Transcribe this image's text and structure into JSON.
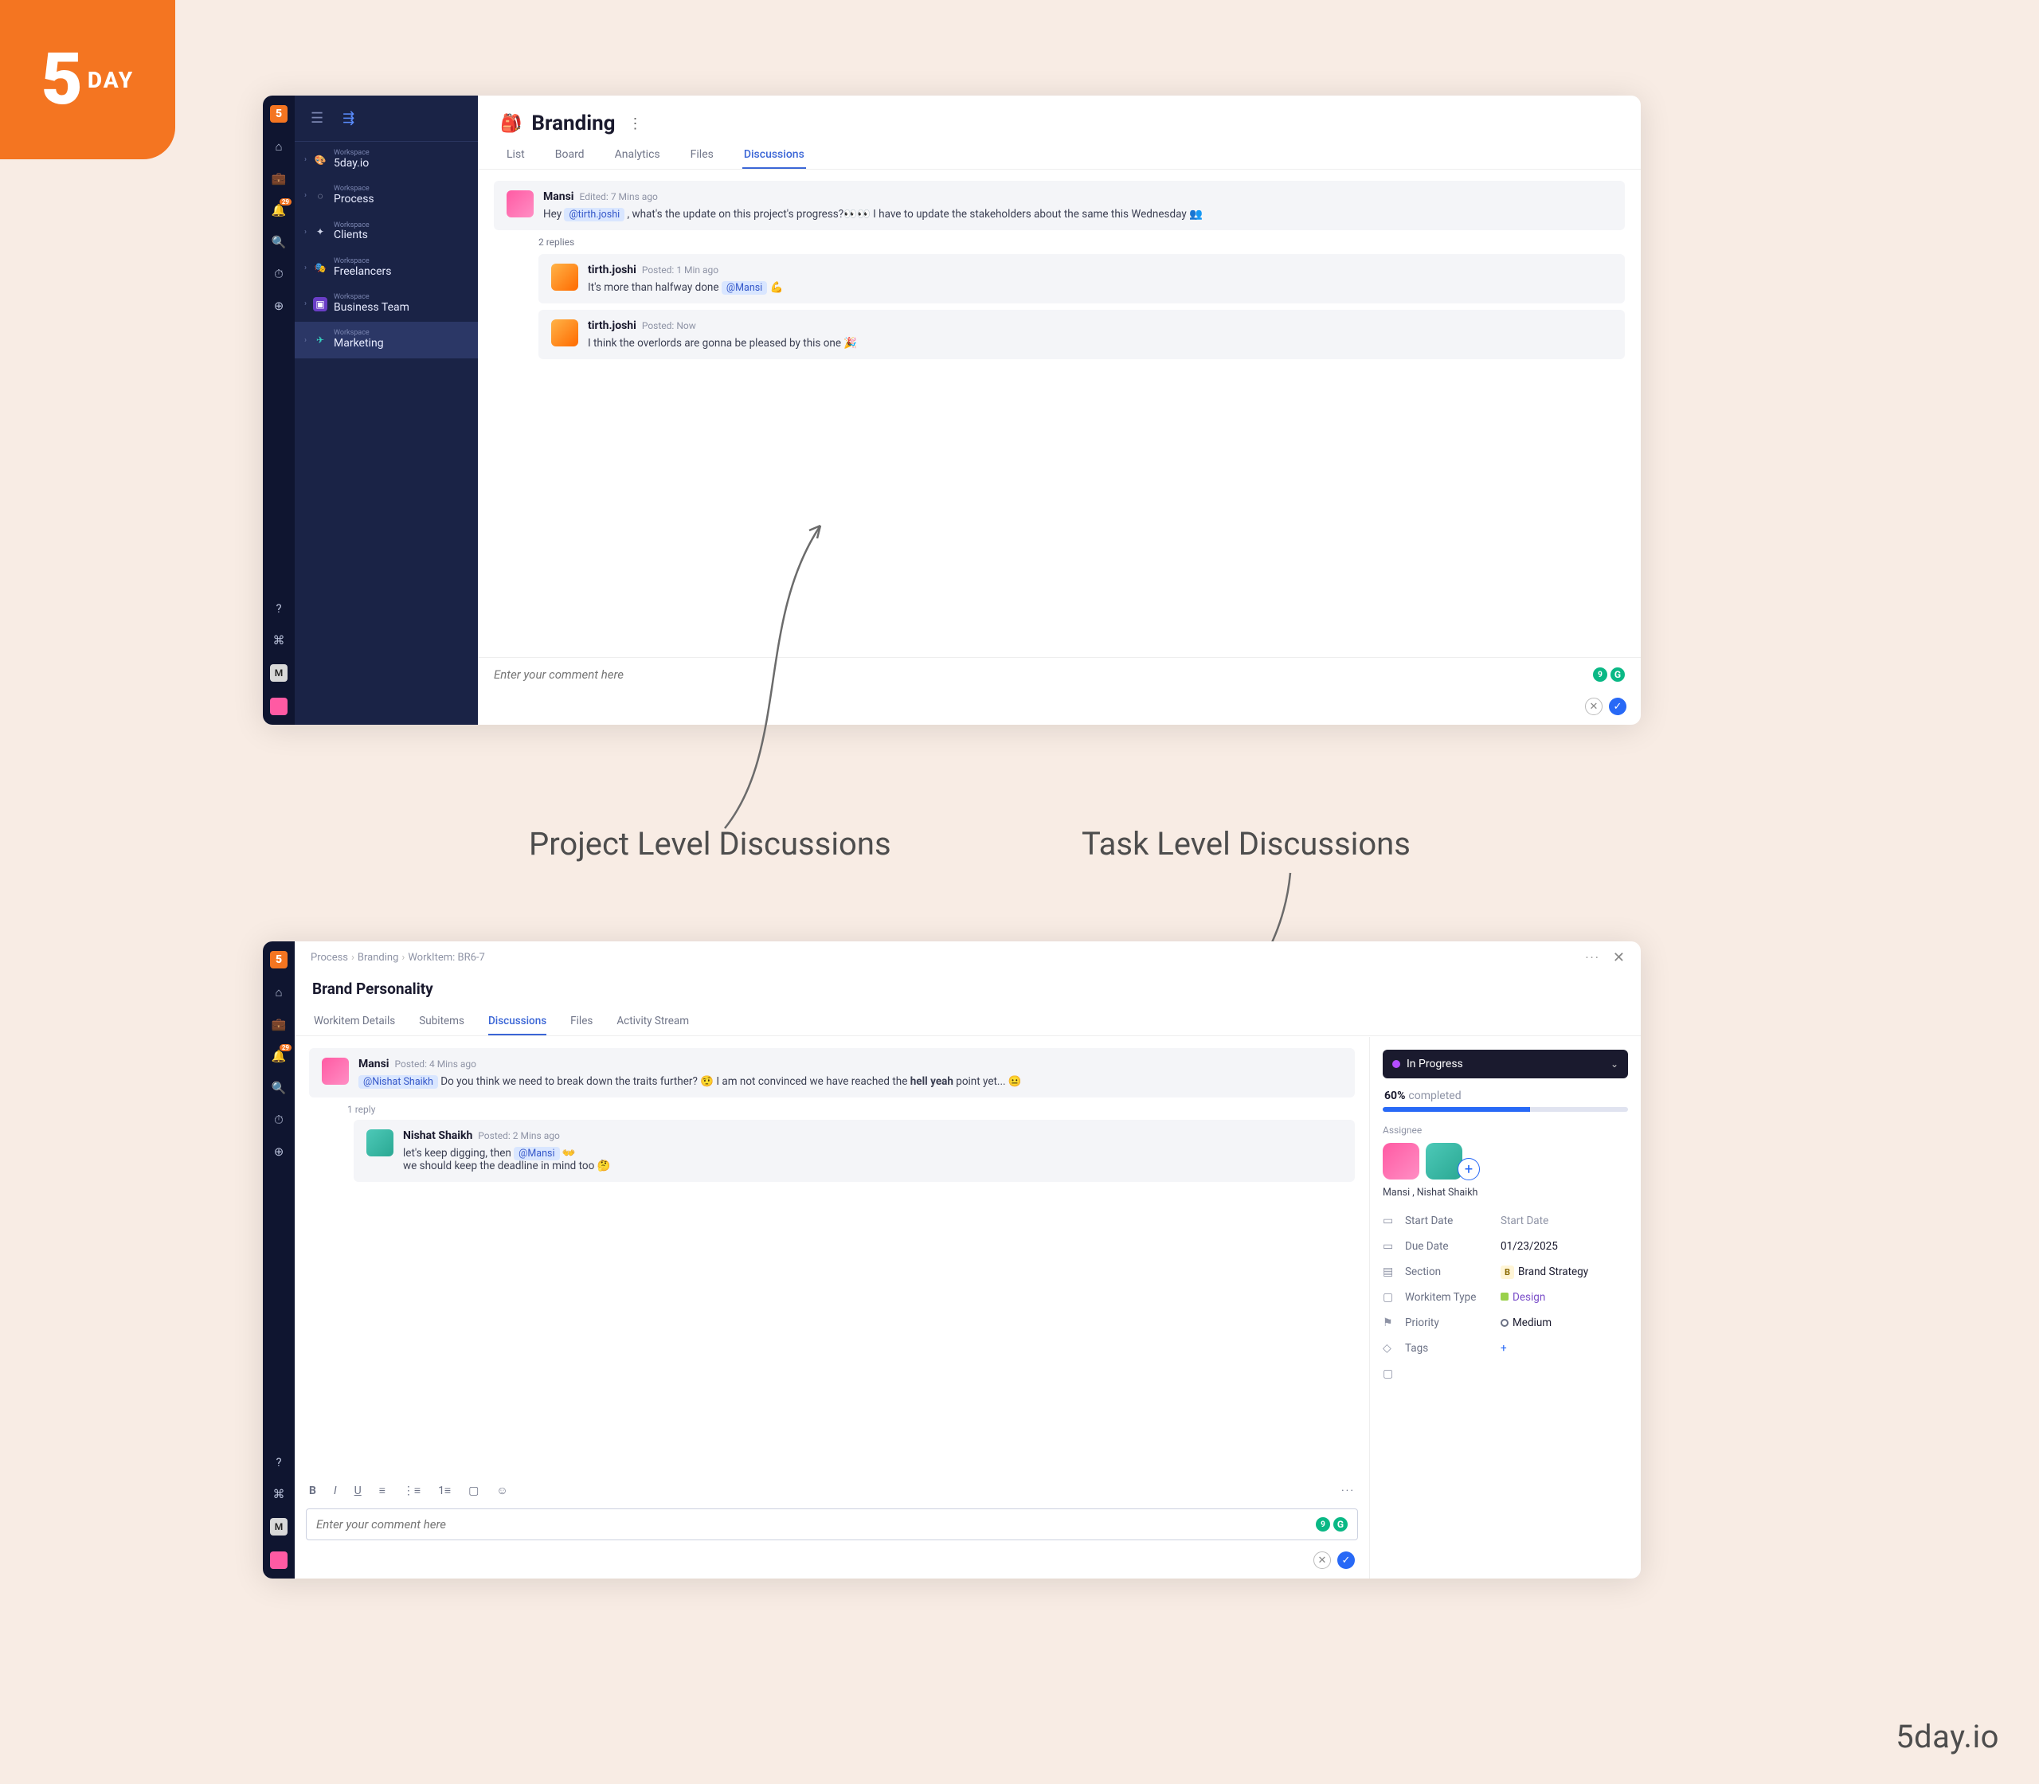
{
  "brand": {
    "logo_text": "5",
    "logo_suffix": "DAY",
    "footer": "5day.io"
  },
  "captions": {
    "project": "Project Level Discussions",
    "task": "Task Level Discussions"
  },
  "rail": {
    "notification_badge": "29",
    "user_initial": "M"
  },
  "sidebar": {
    "workspace_sup": "Workspace",
    "items": [
      {
        "name": "5day.io",
        "icon": "🎨"
      },
      {
        "name": "Process",
        "icon": "◌"
      },
      {
        "name": "Clients",
        "icon": "✦"
      },
      {
        "name": "Freelancers",
        "icon": "🎭"
      },
      {
        "name": "Business Team",
        "icon": "▣"
      },
      {
        "name": "Marketing",
        "icon": "✈"
      }
    ]
  },
  "project": {
    "icon_emoji": "🎒",
    "title": "Branding",
    "tabs": [
      "List",
      "Board",
      "Analytics",
      "Files",
      "Discussions"
    ],
    "comment_placeholder": "Enter your comment here",
    "replies_label": "2 replies",
    "messages": [
      {
        "author": "Mansi",
        "meta_prefix": "Edited:",
        "meta_time": "7 Mins ago",
        "text_pre": "Hey ",
        "mention": "@tirth.joshi",
        "text_post": " , what's the update on this project's progress?👀👀 I have to update the stakeholders about the same this Wednesday 👥",
        "avatar": "pink"
      },
      {
        "author": "tirth.joshi",
        "meta_prefix": "Posted:",
        "meta_time": "1 Min ago",
        "text_pre": "It's more than halfway done ",
        "mention": "@Mansi",
        "text_post": " 💪",
        "avatar": "orange",
        "reply": true
      },
      {
        "author": "tirth.joshi",
        "meta_prefix": "Posted:",
        "meta_time": "Now",
        "text_full": "I think the overlords are gonna be pleased by this one 🎉",
        "avatar": "orange",
        "reply": true
      }
    ]
  },
  "task": {
    "breadcrumb": [
      "Process",
      "Branding",
      "WorkItem: BR6-7"
    ],
    "title": "Brand Personality",
    "tabs": [
      "Workitem Details",
      "Subitems",
      "Discussions",
      "Files",
      "Activity Stream"
    ],
    "comment_placeholder": "Enter your comment here",
    "reply_label": "1 reply",
    "messages": [
      {
        "author": "Mansi",
        "meta_prefix": "Posted:",
        "meta_time": "4 Mins ago",
        "mention": "@Nishat Shaikh",
        "text_post_1": " Do you think we need to break down the traits further? 🤨 I am not convinced we have reached the ",
        "bold": "hell yeah",
        "text_post_2": " point yet... 😐",
        "avatar": "pink"
      },
      {
        "author": "Nishat Shaikh",
        "meta_prefix": "Posted:",
        "meta_time": "2 Mins ago",
        "line1_pre": "let's keep digging, then ",
        "mention": "@Mansi",
        "line1_post": " 👐",
        "line2": "we should keep the deadline in mind too 🤔",
        "avatar": "teal",
        "reply": true
      }
    ],
    "status": {
      "label": "In Progress",
      "progress_pct": "60%",
      "progress_word": "completed"
    },
    "assignees_label": "Assignee",
    "assignees_names": "Mansi , Nishat Shaikh",
    "props": {
      "start_date": {
        "label": "Start Date",
        "value": "Start Date"
      },
      "due_date": {
        "label": "Due Date",
        "value": "01/23/2025"
      },
      "section": {
        "label": "Section",
        "badge": "B",
        "value": "Brand Strategy"
      },
      "type": {
        "label": "Workitem Type",
        "value": "Design"
      },
      "priority": {
        "label": "Priority",
        "value": "Medium"
      },
      "tags": {
        "label": "Tags",
        "value": "+"
      }
    }
  }
}
